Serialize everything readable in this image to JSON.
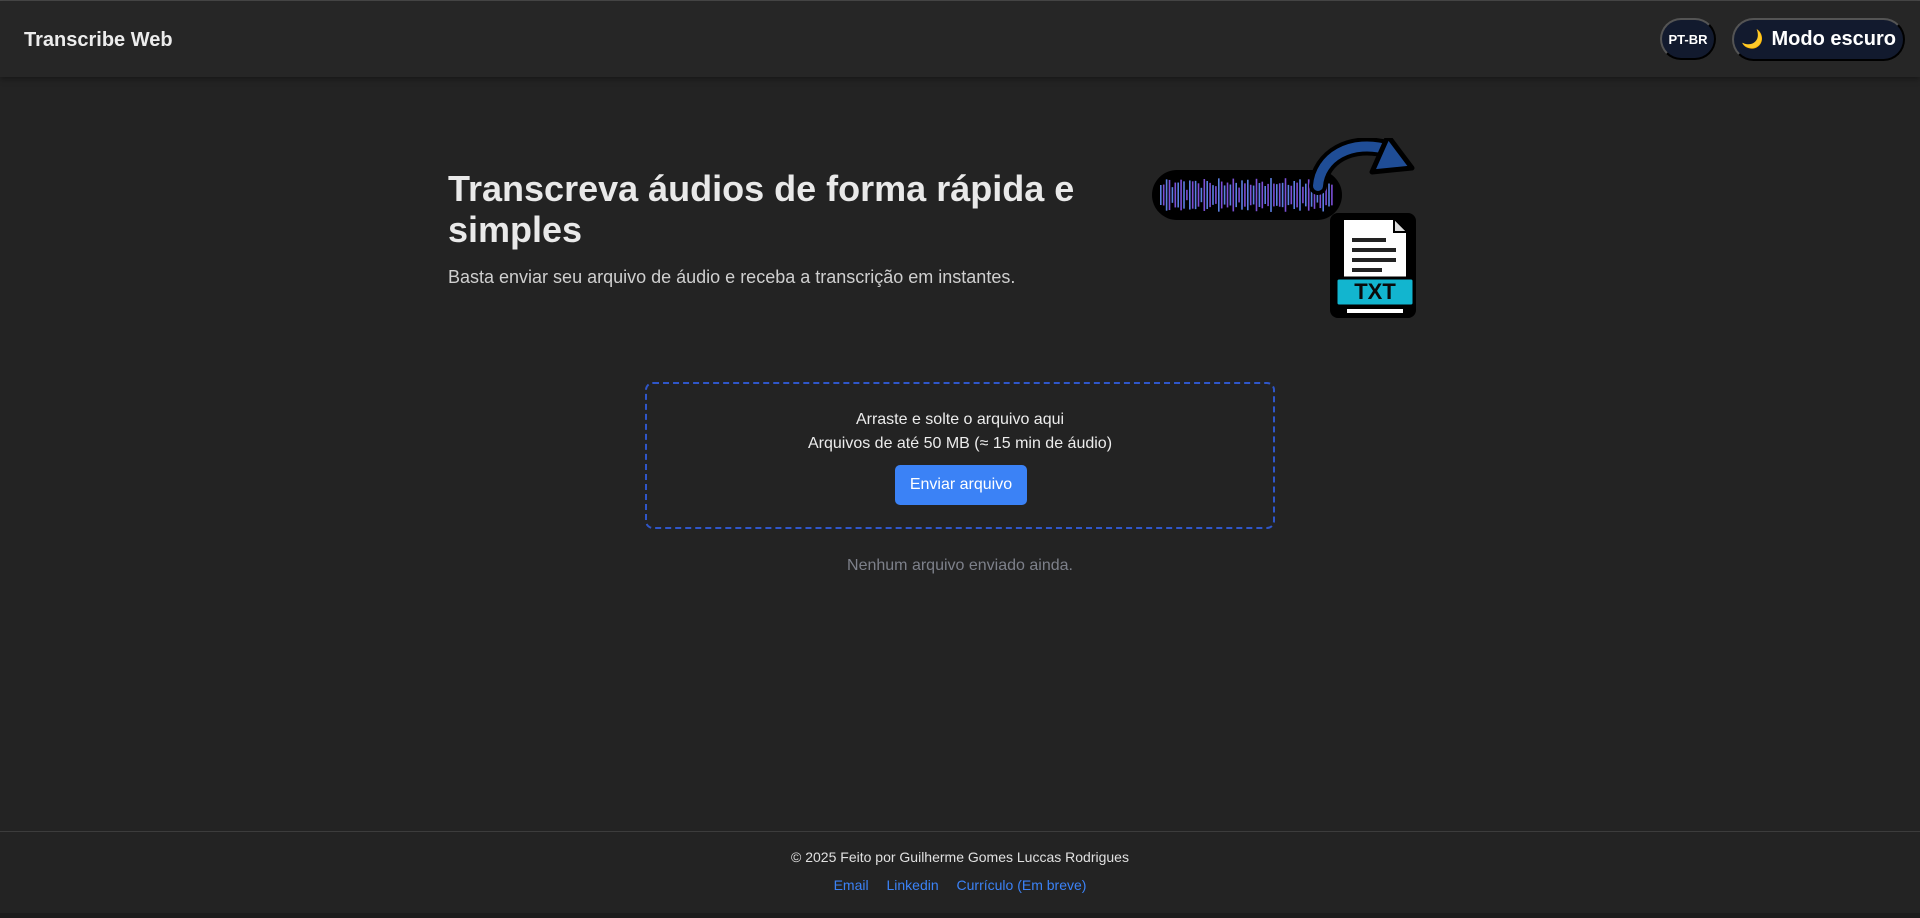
{
  "header": {
    "brand": "Transcribe Web",
    "language_label": "PT-BR",
    "theme_icon": "moon-icon",
    "theme_label": "Modo escuro"
  },
  "hero": {
    "title": "Transcreva áudios de forma rápida e simples",
    "subtitle": "Basta enviar seu arquivo de áudio e receba a transcrição em instantes.",
    "illustration_icon": "audio-to-txt-illustration",
    "illustration_text": "TXT"
  },
  "upload": {
    "drop_text": "Arraste e solte o arquivo aqui",
    "limit_text": "Arquivos de até 50 MB (≈ 15 min de áudio)",
    "button_label": "Enviar arquivo",
    "status_text": "Nenhum arquivo enviado ainda."
  },
  "footer": {
    "copyright": "© 2025 Feito por Guilherme Gomes Luccas Rodrigues",
    "links": [
      "Email",
      "Linkedin",
      "Currículo (Em breve)"
    ]
  },
  "colors": {
    "background": "#232323",
    "accent": "#3b82f6",
    "dropzone_border": "#2f56c9",
    "header_button_bg": "#121a2e"
  }
}
